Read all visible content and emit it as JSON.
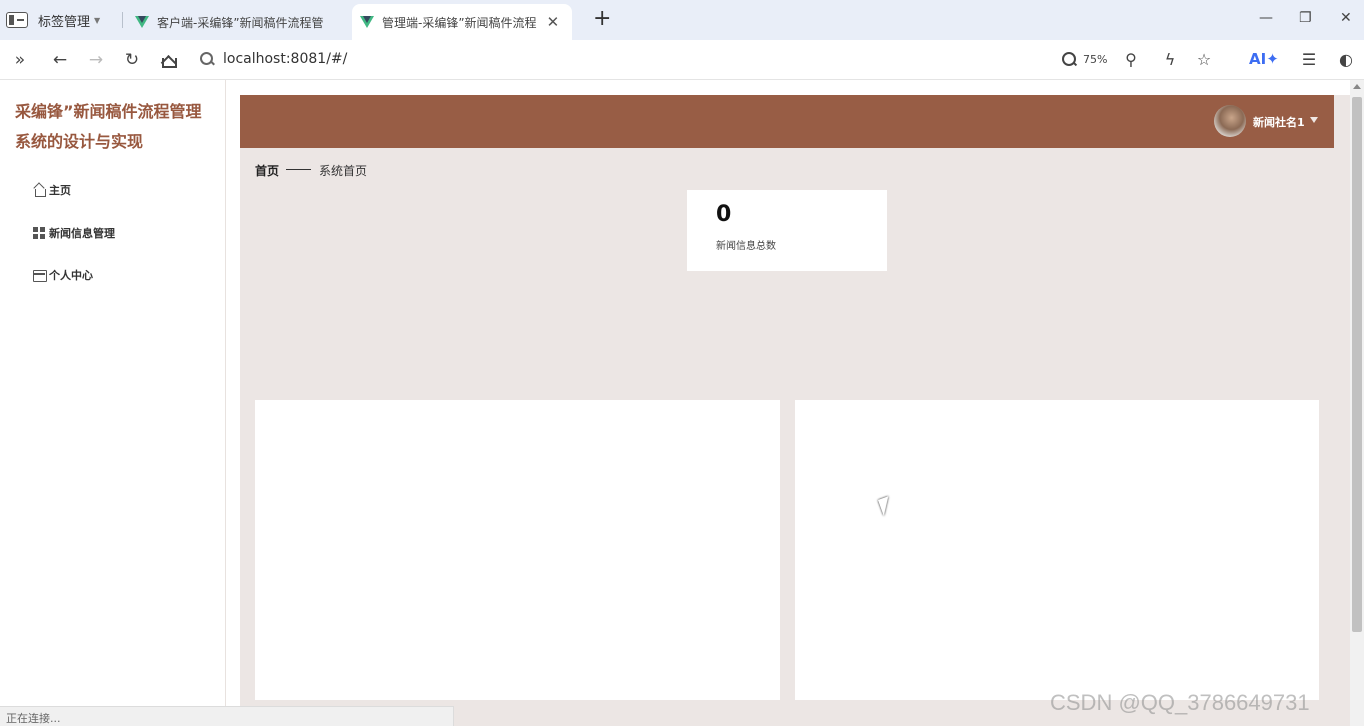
{
  "browser": {
    "tab_manager_label": "标签管理",
    "tabs": [
      {
        "title": "客户端-采编锋”新闻稿件流程管",
        "active": false
      },
      {
        "title": "管理端-采编锋”新闻稿件流程",
        "active": true
      }
    ],
    "url": "localhost:8081/#/",
    "zoom": "75%",
    "ai_label": "AI✦",
    "status_text": "正在连接..."
  },
  "sidebar": {
    "title": "采编锋”新闻稿件流程管理系统的设计与实现",
    "items": [
      {
        "label": "主页",
        "icon": "home-icon"
      },
      {
        "label": "新闻信息管理",
        "icon": "grid-icon"
      },
      {
        "label": "个人中心",
        "icon": "id-card-icon"
      }
    ]
  },
  "header": {
    "username": "新闻社名1"
  },
  "breadcrumb": {
    "home": "首页",
    "current": "系统首页"
  },
  "stats": {
    "count": "0",
    "label": "新闻信息总数"
  },
  "watermark": "CSDN @QQ_3786649731",
  "colors": {
    "header_bg": "#985d45",
    "title_color": "#98583f",
    "content_bg": "#ece6e4"
  }
}
